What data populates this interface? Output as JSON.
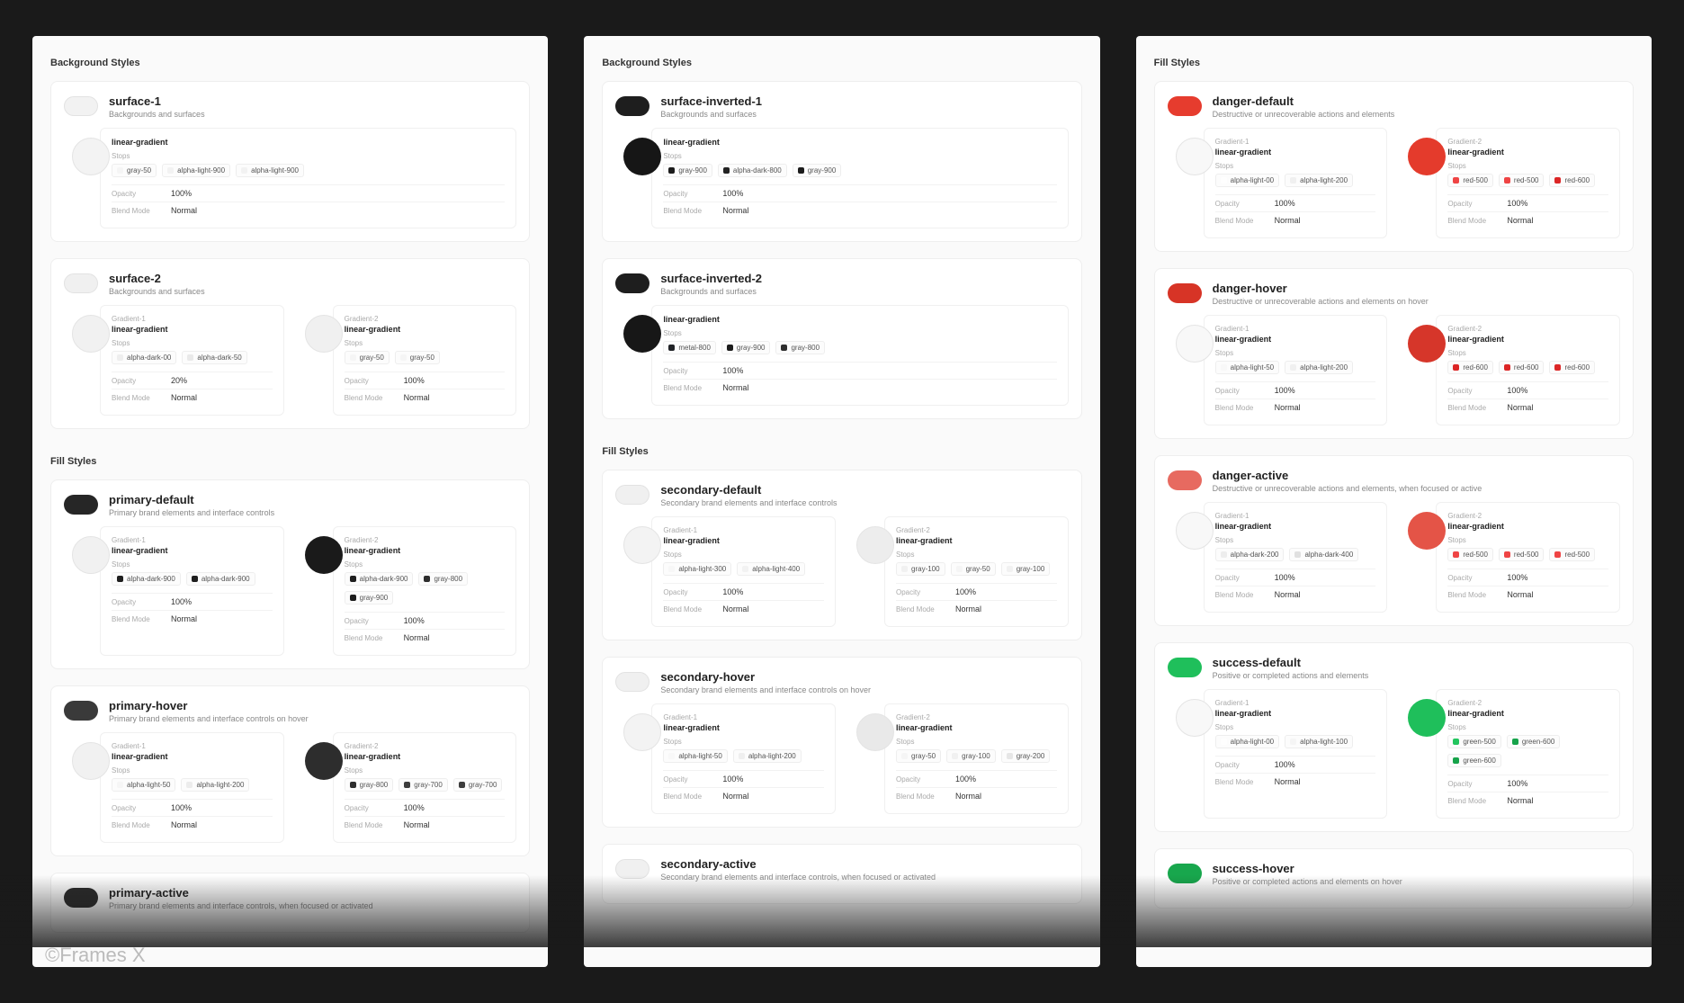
{
  "watermark": "©Frames X",
  "labels": {
    "stops": "Stops",
    "opacity": "Opacity",
    "blend": "Blend Mode",
    "g1": "Gradient-1",
    "g2": "Gradient-2",
    "lg": "linear-gradient"
  },
  "columns": [
    {
      "sections": [
        {
          "title": "Background Styles",
          "styles": [
            {
              "name": "surface-1",
              "desc": "Backgrounds and surfaces",
              "pill": "#f2f2f2",
              "gradients": [
                {
                  "label": null,
                  "swatch": "#f3f3f3",
                  "stops": [
                    {
                      "name": "gray-50",
                      "color": "#f5f5f5"
                    },
                    {
                      "name": "alpha-light-900",
                      "color": "#f2f2f2"
                    },
                    {
                      "name": "alpha-light-900",
                      "color": "#f2f2f2"
                    }
                  ],
                  "opacity": "100%",
                  "blend": "Normal"
                }
              ]
            },
            {
              "name": "surface-2",
              "desc": "Backgrounds and surfaces",
              "pill": "#f0f0f0",
              "gradients": [
                {
                  "label": "Gradient-1",
                  "swatch": "#f1f1f1",
                  "stops": [
                    {
                      "name": "alpha-dark-00",
                      "color": "#eeeeee"
                    },
                    {
                      "name": "alpha-dark-50",
                      "color": "#e9e9e9"
                    }
                  ],
                  "opacity": "20%",
                  "blend": "Normal"
                },
                {
                  "label": "Gradient-2",
                  "swatch": "#f0f0f0",
                  "stops": [
                    {
                      "name": "gray-50",
                      "color": "#f5f5f5"
                    },
                    {
                      "name": "gray-50",
                      "color": "#f5f5f5"
                    }
                  ],
                  "opacity": "100%",
                  "blend": "Normal"
                }
              ]
            }
          ]
        },
        {
          "title": "Fill Styles",
          "styles": [
            {
              "name": "primary-default",
              "desc": "Primary brand elements and interface controls",
              "pill": "#262626",
              "gradients": [
                {
                  "label": "Gradient-1",
                  "swatch": "#f1f1f1",
                  "stops": [
                    {
                      "name": "alpha-dark-900",
                      "color": "#1f1f1f"
                    },
                    {
                      "name": "alpha-dark-900",
                      "color": "#1f1f1f"
                    }
                  ],
                  "opacity": "100%",
                  "blend": "Normal"
                },
                {
                  "label": "Gradient-2",
                  "swatch": "#1a1a1a",
                  "stops": [
                    {
                      "name": "alpha-dark-900",
                      "color": "#1f1f1f"
                    },
                    {
                      "name": "gray-800",
                      "color": "#2e2e2e"
                    },
                    {
                      "name": "gray-900",
                      "color": "#1c1c1c"
                    }
                  ],
                  "opacity": "100%",
                  "blend": "Normal"
                }
              ]
            },
            {
              "name": "primary-hover",
              "desc": "Primary brand elements and interface controls on hover",
              "pill": "#3a3a3a",
              "gradients": [
                {
                  "label": "Gradient-1",
                  "swatch": "#f1f1f1",
                  "stops": [
                    {
                      "name": "alpha-light-50",
                      "color": "#f6f6f6"
                    },
                    {
                      "name": "alpha-light-200",
                      "color": "#ececec"
                    }
                  ],
                  "opacity": "100%",
                  "blend": "Normal"
                },
                {
                  "label": "Gradient-2",
                  "swatch": "#2d2d2d",
                  "stops": [
                    {
                      "name": "gray-800",
                      "color": "#2e2e2e"
                    },
                    {
                      "name": "gray-700",
                      "color": "#3d3d3d"
                    },
                    {
                      "name": "gray-700",
                      "color": "#3d3d3d"
                    }
                  ],
                  "opacity": "100%",
                  "blend": "Normal"
                }
              ]
            },
            {
              "name": "primary-active",
              "desc": "Primary brand elements and interface controls, when focused or activated",
              "pill": "#2b2b2b",
              "gradients": []
            }
          ]
        }
      ]
    },
    {
      "sections": [
        {
          "title": "Background Styles",
          "styles": [
            {
              "name": "surface-inverted-1",
              "desc": "Backgrounds and surfaces",
              "pill": "#1e1e1e",
              "gradients": [
                {
                  "label": null,
                  "swatch": "#161616",
                  "stops": [
                    {
                      "name": "gray-900",
                      "color": "#1c1c1c"
                    },
                    {
                      "name": "alpha-dark-800",
                      "color": "#222222"
                    },
                    {
                      "name": "gray-900",
                      "color": "#1c1c1c"
                    }
                  ],
                  "opacity": "100%",
                  "blend": "Normal"
                }
              ]
            },
            {
              "name": "surface-inverted-2",
              "desc": "Backgrounds and surfaces",
              "pill": "#1e1e1e",
              "gradients": [
                {
                  "label": null,
                  "swatch": "#171717",
                  "stops": [
                    {
                      "name": "metal-800",
                      "color": "#202226"
                    },
                    {
                      "name": "gray-900",
                      "color": "#1c1c1c"
                    },
                    {
                      "name": "gray-800",
                      "color": "#2e2e2e"
                    }
                  ],
                  "opacity": "100%",
                  "blend": "Normal"
                }
              ]
            }
          ]
        },
        {
          "title": "Fill Styles",
          "styles": [
            {
              "name": "secondary-default",
              "desc": "Secondary brand elements and interface controls",
              "pill": "#f0f0f0",
              "gradients": [
                {
                  "label": "Gradient-1",
                  "swatch": "#f3f3f3",
                  "stops": [
                    {
                      "name": "alpha-light-300",
                      "color": "#f7f7f7"
                    },
                    {
                      "name": "alpha-light-400",
                      "color": "#f2f2f2"
                    }
                  ],
                  "opacity": "100%",
                  "blend": "Normal"
                },
                {
                  "label": "Gradient-2",
                  "swatch": "#ededed",
                  "stops": [
                    {
                      "name": "gray-100",
                      "color": "#f1f1f1"
                    },
                    {
                      "name": "gray-50",
                      "color": "#f5f5f5"
                    },
                    {
                      "name": "gray-100",
                      "color": "#f1f1f1"
                    }
                  ],
                  "opacity": "100%",
                  "blend": "Normal"
                }
              ]
            },
            {
              "name": "secondary-hover",
              "desc": "Secondary brand elements and interface controls on hover",
              "pill": "#f0f0f0",
              "gradients": [
                {
                  "label": "Gradient-1",
                  "swatch": "#f3f3f3",
                  "stops": [
                    {
                      "name": "alpha-light-50",
                      "color": "#f8f8f8"
                    },
                    {
                      "name": "alpha-light-200",
                      "color": "#efefef"
                    }
                  ],
                  "opacity": "100%",
                  "blend": "Normal"
                },
                {
                  "label": "Gradient-2",
                  "swatch": "#e9e9e9",
                  "stops": [
                    {
                      "name": "gray-50",
                      "color": "#f5f5f5"
                    },
                    {
                      "name": "gray-100",
                      "color": "#f1f1f1"
                    },
                    {
                      "name": "gray-200",
                      "color": "#e6e6e6"
                    }
                  ],
                  "opacity": "100%",
                  "blend": "Normal"
                }
              ]
            },
            {
              "name": "secondary-active",
              "desc": "Secondary brand elements and interface controls, when focused or activated",
              "pill": "#f0f0f0",
              "gradients": []
            }
          ]
        }
      ]
    },
    {
      "sections": [
        {
          "title": "Fill Styles",
          "styles": [
            {
              "name": "danger-default",
              "desc": "Destructive or unrecoverable actions and elements",
              "pill": "#e63c2e",
              "gradients": [
                {
                  "label": "Gradient-1",
                  "swatch": "#f8f8f8",
                  "stops": [
                    {
                      "name": "alpha-light-00",
                      "color": "#fefefe"
                    },
                    {
                      "name": "alpha-light-200",
                      "color": "#f0f0f0"
                    }
                  ],
                  "opacity": "100%",
                  "blend": "Normal"
                },
                {
                  "label": "Gradient-2",
                  "swatch": "#e43b2c",
                  "stops": [
                    {
                      "name": "red-500",
                      "color": "#ef4444"
                    },
                    {
                      "name": "red-500",
                      "color": "#ef4444"
                    },
                    {
                      "name": "red-600",
                      "color": "#dc2626"
                    }
                  ],
                  "opacity": "100%",
                  "blend": "Normal"
                }
              ]
            },
            {
              "name": "danger-hover",
              "desc": "Destructive or unrecoverable actions and elements on hover",
              "pill": "#d73426",
              "gradients": [
                {
                  "label": "Gradient-1",
                  "swatch": "#f8f8f8",
                  "stops": [
                    {
                      "name": "alpha-light-50",
                      "color": "#f8f8f8"
                    },
                    {
                      "name": "alpha-light-200",
                      "color": "#f0f0f0"
                    }
                  ],
                  "opacity": "100%",
                  "blend": "Normal"
                },
                {
                  "label": "Gradient-2",
                  "swatch": "#d6362a",
                  "stops": [
                    {
                      "name": "red-600",
                      "color": "#dc2626"
                    },
                    {
                      "name": "red-600",
                      "color": "#dc2626"
                    },
                    {
                      "name": "red-600",
                      "color": "#dc2626"
                    }
                  ],
                  "opacity": "100%",
                  "blend": "Normal"
                }
              ]
            },
            {
              "name": "danger-active",
              "desc": "Destructive or unrecoverable actions and elements, when focused or active",
              "pill": "#e76a60",
              "gradients": [
                {
                  "label": "Gradient-1",
                  "swatch": "#f8f8f8",
                  "stops": [
                    {
                      "name": "alpha-dark-200",
                      "color": "#ededed"
                    },
                    {
                      "name": "alpha-dark-400",
                      "color": "#e0e0e0"
                    }
                  ],
                  "opacity": "100%",
                  "blend": "Normal"
                },
                {
                  "label": "Gradient-2",
                  "swatch": "#e45447",
                  "stops": [
                    {
                      "name": "red-500",
                      "color": "#ef4444"
                    },
                    {
                      "name": "red-500",
                      "color": "#ef4444"
                    },
                    {
                      "name": "red-500",
                      "color": "#ef4444"
                    }
                  ],
                  "opacity": "100%",
                  "blend": "Normal"
                }
              ]
            },
            {
              "name": "success-default",
              "desc": "Positive or completed actions and elements",
              "pill": "#1fbf5b",
              "gradients": [
                {
                  "label": "Gradient-1",
                  "swatch": "#f8f8f8",
                  "stops": [
                    {
                      "name": "alpha-light-00",
                      "color": "#fefefe"
                    },
                    {
                      "name": "alpha-light-100",
                      "color": "#f5f5f5"
                    }
                  ],
                  "opacity": "100%",
                  "blend": "Normal"
                },
                {
                  "label": "Gradient-2",
                  "swatch": "#1fbf5b",
                  "stops": [
                    {
                      "name": "green-500",
                      "color": "#22c55e"
                    },
                    {
                      "name": "green-600",
                      "color": "#16a34a"
                    },
                    {
                      "name": "green-600",
                      "color": "#16a34a"
                    }
                  ],
                  "opacity": "100%",
                  "blend": "Normal"
                }
              ]
            },
            {
              "name": "success-hover",
              "desc": "Positive or completed actions and elements on hover",
              "pill": "#18a74d",
              "gradients": []
            }
          ]
        }
      ]
    }
  ]
}
